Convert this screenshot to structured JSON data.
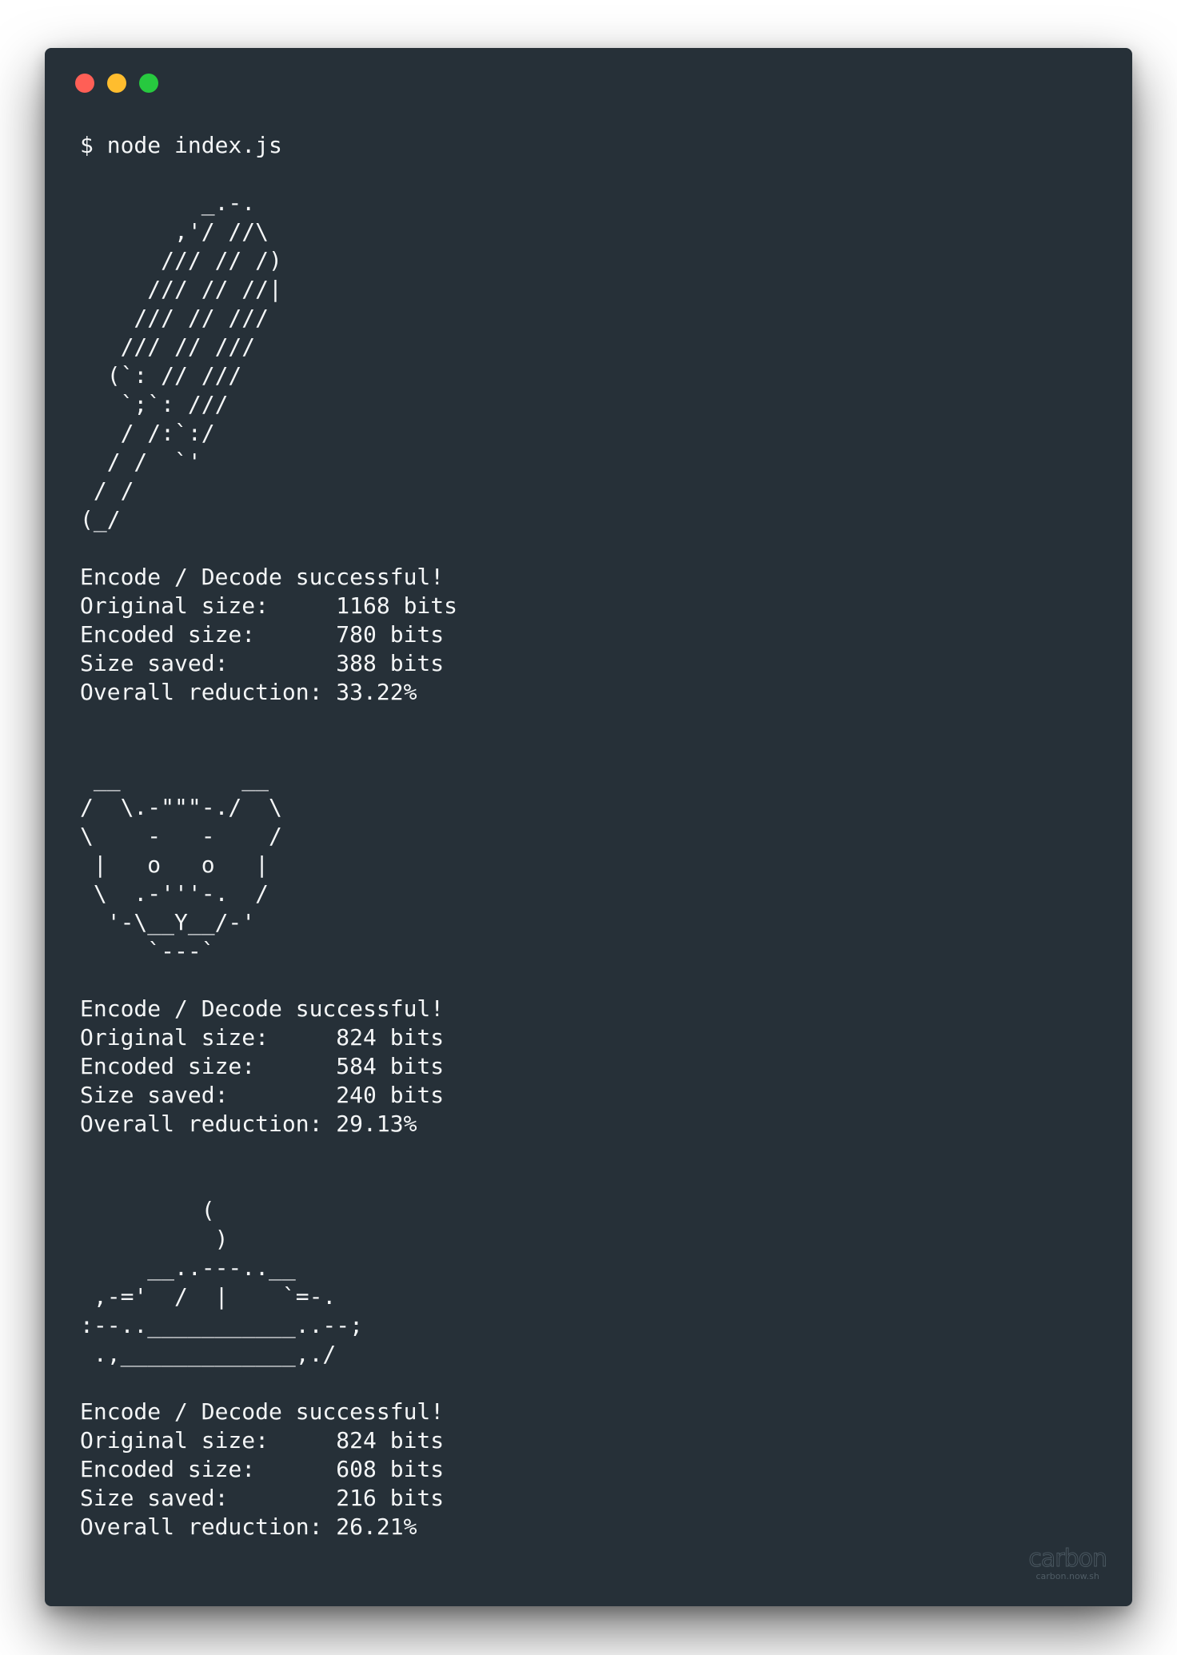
{
  "window": {
    "controls": {
      "close_color": "#ff5f56",
      "minimize_color": "#ffbd2e",
      "maximize_color": "#27c93f"
    },
    "background": "#263038"
  },
  "terminal": {
    "lines": [
      "$ node index.js",
      "",
      "         _.-.",
      "       ,'/ //\\",
      "      /// // /)",
      "     /// // //|",
      "    /// // ///",
      "   /// // ///",
      "  (`: // ///",
      "   `;`: ///",
      "   / /:`:/",
      "  / /  `'",
      " / /",
      "(_/",
      "",
      "Encode / Decode successful!",
      "Original size:     1168 bits",
      "Encoded size:      780 bits",
      "Size saved:        388 bits",
      "Overall reduction: 33.22%",
      "",
      "",
      " __         __",
      "/  \\.-\"\"\"-./  \\",
      "\\    -   -    /",
      " |   o   o   |",
      " \\  .-'''-.  /",
      "  '-\\__Y__/-'",
      "     `---`",
      "",
      "Encode / Decode successful!",
      "Original size:     824 bits",
      "Encoded size:      584 bits",
      "Size saved:        240 bits",
      "Overall reduction: 29.13%",
      "",
      "",
      "         (",
      "          )",
      "     __..---..__",
      " ,-='  /  |    `=-.",
      ":--..___________..--;",
      " .,_____________,./",
      "",
      "Encode / Decode successful!",
      "Original size:     824 bits",
      "Encoded size:      608 bits",
      "Size saved:        216 bits",
      "Overall reduction: 26.21%"
    ]
  },
  "watermark": {
    "logo": "carbon",
    "url": "carbon.now.sh"
  }
}
